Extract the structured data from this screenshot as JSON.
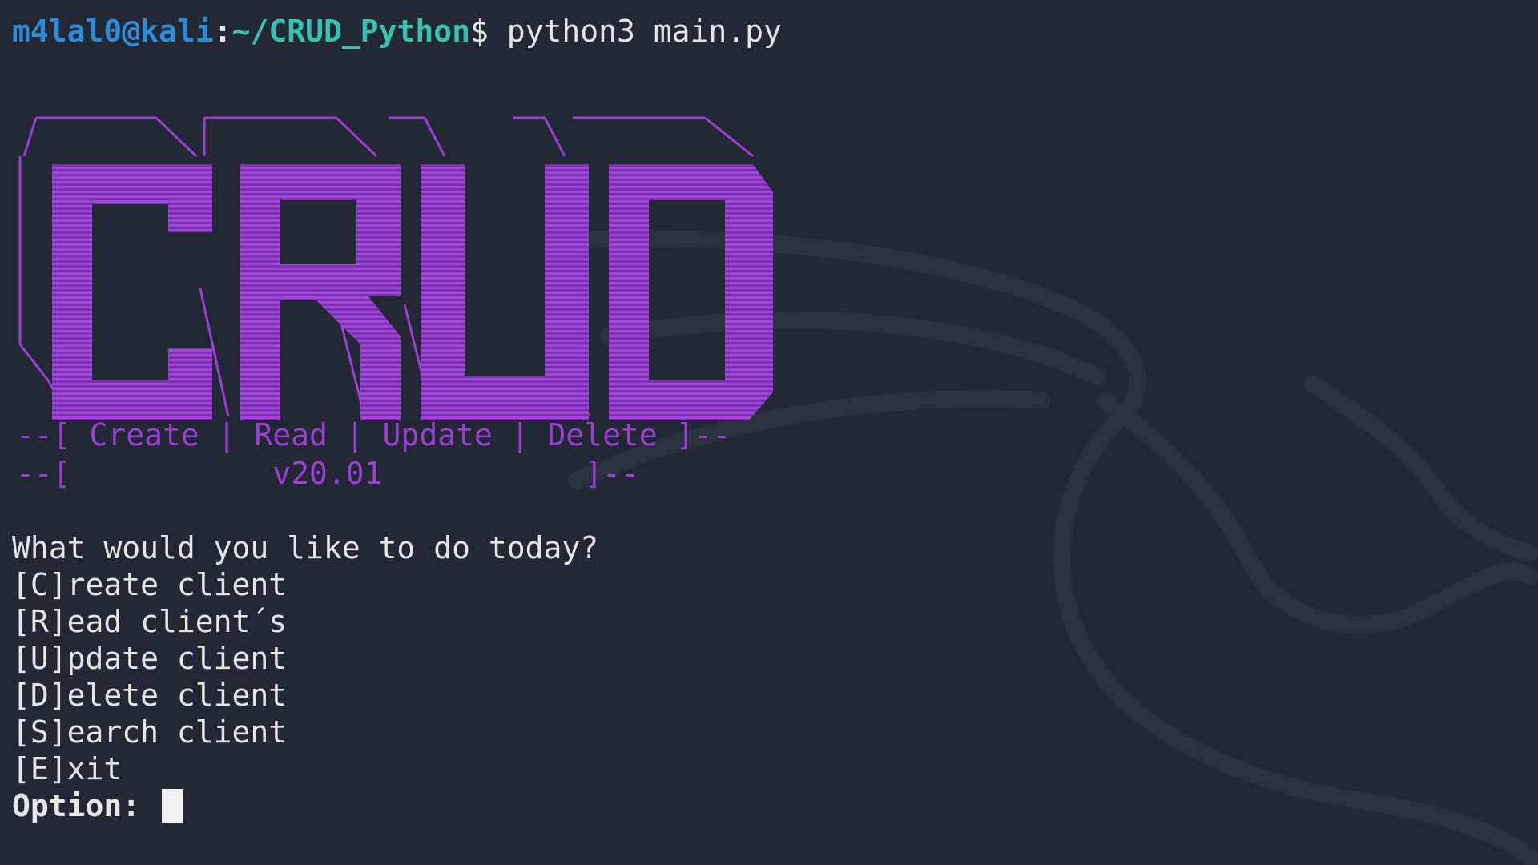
{
  "prompt": {
    "user_host": "m4lal0@kali",
    "separator": ":",
    "path": "~/CRUD_Python",
    "dollar": "$",
    "command": "python3 main.py"
  },
  "banner": {
    "logo_text": "CRUD",
    "subtitle": "--[ Create | Read | Update | Delete ]--",
    "version_line": "--[           v20.01           ]--"
  },
  "menu": {
    "question": "What would you like to do today?",
    "options": [
      "[C]reate client",
      "[R]ead client´s",
      "[U]pdate client",
      "[D]elete client",
      "[S]earch client",
      "[E]xit"
    ],
    "input_label": "Option:"
  },
  "colors": {
    "background": "#222834",
    "banner": "#9b3fd3",
    "prompt_user": "#2e8bd6",
    "prompt_path": "#38c0b0"
  },
  "icons": {
    "watermark": "kali-dragon-icon",
    "cursor": "block-cursor"
  }
}
